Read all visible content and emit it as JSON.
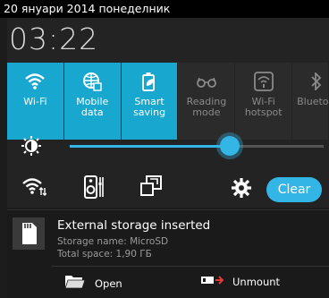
{
  "status_bar": {
    "date": "20 януари 2014 понеделник"
  },
  "clock": "03:22",
  "tiles": [
    {
      "label": "Wi-Fi",
      "icon": "wifi-icon",
      "state": "on"
    },
    {
      "label": "Mobile data",
      "icon": "globe-icon",
      "state": "on"
    },
    {
      "label": "Smart saving",
      "icon": "leaf-battery-icon",
      "state": "on"
    },
    {
      "label": "Reading mode",
      "icon": "glasses-icon",
      "state": "off"
    },
    {
      "label": "Wi-Fi hotspot",
      "icon": "hotspot-icon",
      "state": "off"
    },
    {
      "label": "Bluetooth",
      "icon": "bluetooth-icon",
      "state": "off"
    }
  ],
  "brightness": {
    "level": 0.63
  },
  "quick_actions": {
    "clear_label": "Clear"
  },
  "notification": {
    "title": "External storage inserted",
    "line1": "Storage name: MicroSD",
    "line2": "Total space: 1,90 ГБ",
    "open_label": "Open",
    "unmount_label": "Unmount"
  },
  "colors": {
    "accent": "#33b5e5",
    "tile_on": "#17a7cf"
  }
}
